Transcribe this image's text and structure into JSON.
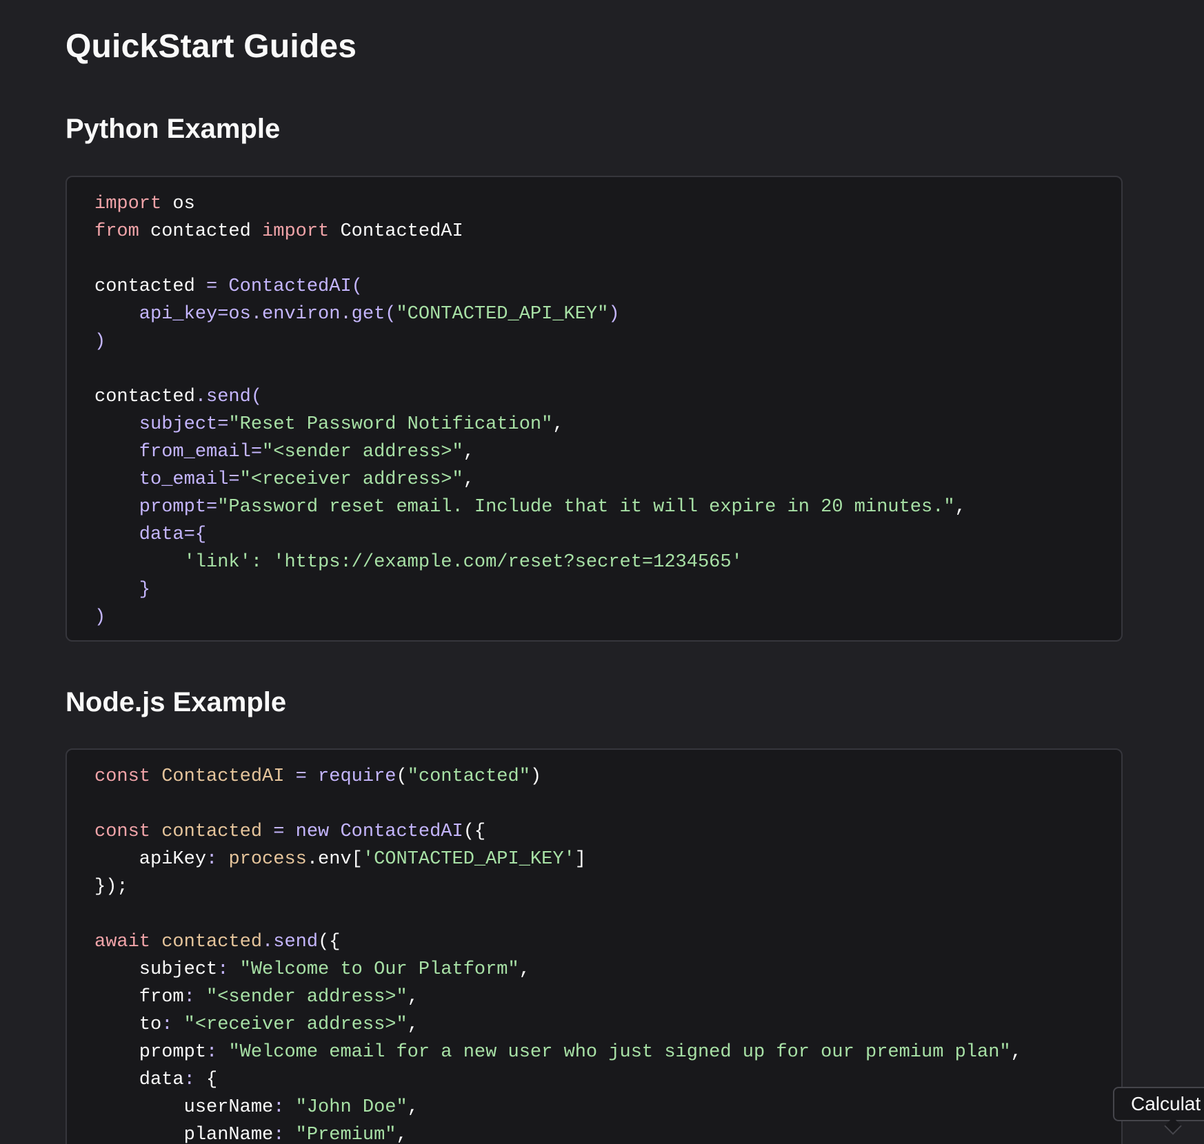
{
  "page": {
    "title": "QuickStart Guides"
  },
  "colors": {
    "keyword": "#f0a3a8",
    "function": "#c4b5fd",
    "string": "#a7e0a5",
    "identifier": "#e5c49b",
    "plain": "#fafafa",
    "background": "#202024",
    "code_background": "#18181b"
  },
  "sections": [
    {
      "heading": "Python Example",
      "lines": [
        [
          {
            "t": "import",
            "c": "keyword"
          },
          {
            "t": " os",
            "c": "plain"
          }
        ],
        [
          {
            "t": "from",
            "c": "keyword"
          },
          {
            "t": " contacted ",
            "c": "plain"
          },
          {
            "t": "import",
            "c": "keyword"
          },
          {
            "t": " ContactedAI",
            "c": "plain"
          }
        ],
        [],
        [
          {
            "t": "contacted ",
            "c": "plain"
          },
          {
            "t": "= ContactedAI(",
            "c": "function"
          }
        ],
        [
          {
            "t": "    api_key=os.environ.get(",
            "c": "function"
          },
          {
            "t": "\"CONTACTED_API_KEY\"",
            "c": "string"
          },
          {
            "t": ")",
            "c": "function"
          }
        ],
        [
          {
            "t": ")",
            "c": "function"
          }
        ],
        [],
        [
          {
            "t": "contacted",
            "c": "plain"
          },
          {
            "t": ".send(",
            "c": "function"
          }
        ],
        [
          {
            "t": "    subject=",
            "c": "function"
          },
          {
            "t": "\"Reset Password Notification\"",
            "c": "string"
          },
          {
            "t": ",",
            "c": "plain"
          }
        ],
        [
          {
            "t": "    from_email=",
            "c": "function"
          },
          {
            "t": "\"<sender address>\"",
            "c": "string"
          },
          {
            "t": ",",
            "c": "plain"
          }
        ],
        [
          {
            "t": "    to_email=",
            "c": "function"
          },
          {
            "t": "\"<receiver address>\"",
            "c": "string"
          },
          {
            "t": ",",
            "c": "plain"
          }
        ],
        [
          {
            "t": "    prompt=",
            "c": "function"
          },
          {
            "t": "\"Password reset email. Include that it will expire in 20 minutes.\"",
            "c": "string"
          },
          {
            "t": ",",
            "c": "plain"
          }
        ],
        [
          {
            "t": "    data={",
            "c": "function"
          }
        ],
        [
          {
            "t": "        'link': 'https://example.com/reset?secret=1234565'",
            "c": "string"
          }
        ],
        [
          {
            "t": "    }",
            "c": "function"
          }
        ],
        [
          {
            "t": ")",
            "c": "function"
          }
        ]
      ]
    },
    {
      "heading": "Node.js Example",
      "lines": [
        [
          {
            "t": "const",
            "c": "keyword"
          },
          {
            "t": " ContactedAI ",
            "c": "identifier"
          },
          {
            "t": "= require",
            "c": "function"
          },
          {
            "t": "(",
            "c": "plain"
          },
          {
            "t": "\"contacted\"",
            "c": "string"
          },
          {
            "t": ")",
            "c": "plain"
          }
        ],
        [],
        [
          {
            "t": "const",
            "c": "keyword"
          },
          {
            "t": " contacted ",
            "c": "identifier"
          },
          {
            "t": "= new ContactedAI",
            "c": "function"
          },
          {
            "t": "({",
            "c": "plain"
          }
        ],
        [
          {
            "t": "    apiKey",
            "c": "plain"
          },
          {
            "t": ": ",
            "c": "function"
          },
          {
            "t": "process",
            "c": "identifier"
          },
          {
            "t": ".env[",
            "c": "plain"
          },
          {
            "t": "'CONTACTED_API_KEY'",
            "c": "string"
          },
          {
            "t": "]",
            "c": "plain"
          }
        ],
        [
          {
            "t": "});",
            "c": "plain"
          }
        ],
        [],
        [
          {
            "t": "await",
            "c": "keyword"
          },
          {
            "t": " contacted",
            "c": "identifier"
          },
          {
            "t": ".send",
            "c": "function"
          },
          {
            "t": "({",
            "c": "plain"
          }
        ],
        [
          {
            "t": "    subject",
            "c": "plain"
          },
          {
            "t": ": ",
            "c": "function"
          },
          {
            "t": "\"Welcome to Our Platform\"",
            "c": "string"
          },
          {
            "t": ",",
            "c": "plain"
          }
        ],
        [
          {
            "t": "    from",
            "c": "plain"
          },
          {
            "t": ": ",
            "c": "function"
          },
          {
            "t": "\"<sender address>\"",
            "c": "string"
          },
          {
            "t": ",",
            "c": "plain"
          }
        ],
        [
          {
            "t": "    to",
            "c": "plain"
          },
          {
            "t": ": ",
            "c": "function"
          },
          {
            "t": "\"<receiver address>\"",
            "c": "string"
          },
          {
            "t": ",",
            "c": "plain"
          }
        ],
        [
          {
            "t": "    prompt",
            "c": "plain"
          },
          {
            "t": ": ",
            "c": "function"
          },
          {
            "t": "\"Welcome email for a new user who just signed up for our premium plan\"",
            "c": "string"
          },
          {
            "t": ",",
            "c": "plain"
          }
        ],
        [
          {
            "t": "    data",
            "c": "plain"
          },
          {
            "t": ": ",
            "c": "function"
          },
          {
            "t": "{",
            "c": "plain"
          }
        ],
        [
          {
            "t": "        userName",
            "c": "plain"
          },
          {
            "t": ": ",
            "c": "function"
          },
          {
            "t": "\"John Doe\"",
            "c": "string"
          },
          {
            "t": ",",
            "c": "plain"
          }
        ],
        [
          {
            "t": "        planName",
            "c": "plain"
          },
          {
            "t": ": ",
            "c": "function"
          },
          {
            "t": "\"Premium\"",
            "c": "string"
          },
          {
            "t": ",",
            "c": "plain"
          }
        ]
      ]
    }
  ],
  "tooltip": {
    "label": "Calculat"
  }
}
